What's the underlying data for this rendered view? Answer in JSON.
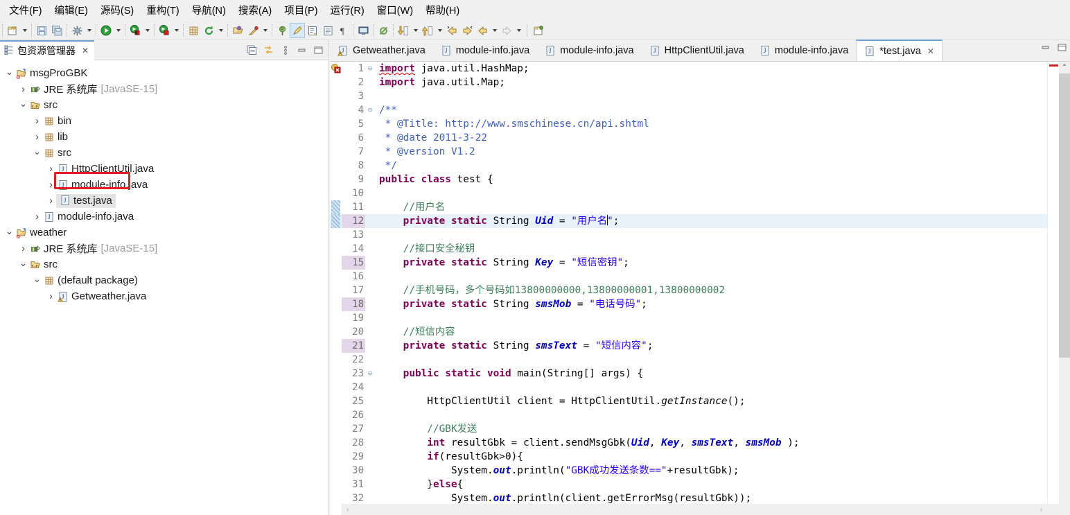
{
  "menu": {
    "items": [
      {
        "label": "文件(F)",
        "name": "menu-file"
      },
      {
        "label": "编辑(E)",
        "name": "menu-edit"
      },
      {
        "label": "源码(S)",
        "name": "menu-source"
      },
      {
        "label": "重构(T)",
        "name": "menu-refactor"
      },
      {
        "label": "导航(N)",
        "name": "menu-navigate"
      },
      {
        "label": "搜索(A)",
        "name": "menu-search"
      },
      {
        "label": "项目(P)",
        "name": "menu-project"
      },
      {
        "label": "运行(R)",
        "name": "menu-run"
      },
      {
        "label": "窗口(W)",
        "name": "menu-window"
      },
      {
        "label": "帮助(H)",
        "name": "menu-help"
      }
    ]
  },
  "toolbar": {
    "buttons": [
      "new-icon",
      "save-icon",
      "save-all-icon",
      "build-icon",
      "run-icon",
      "debug-icon",
      "coverage-icon",
      "new-package-icon",
      "refresh-icon",
      "open-type-icon",
      "search-icon",
      "annotation-icon",
      "marker-icon",
      "toggle-breadcrumb-icon",
      "outline-icon",
      "pilcrow-icon",
      "console-icon",
      "skip-breakpoints-icon",
      "step-down-icon",
      "step-up-icon",
      "prev-annotation-icon",
      "next-annotation-icon",
      "back-icon",
      "forward-icon",
      "new-window-icon"
    ]
  },
  "left_panel": {
    "tab_title": "包资源管理器",
    "tab_close": "✕",
    "tools": [
      "collapse-all-icon",
      "link-with-editor-icon",
      "view-menu-icon",
      "minimize-icon",
      "maximize-icon"
    ],
    "tree": [
      {
        "name": "tree-item-msgprogbk",
        "label": "msgProGBK",
        "sub": "",
        "depth": 0,
        "twisty": "down",
        "icon": "java-project-icon",
        "selected": false
      },
      {
        "name": "tree-item-jre-msgprogbk",
        "label": "JRE 系统库",
        "sub": "[JavaSE-15]",
        "depth": 1,
        "twisty": "right",
        "icon": "library-icon",
        "selected": false
      },
      {
        "name": "tree-item-src-msgprogbk",
        "label": "src",
        "sub": "",
        "depth": 1,
        "twisty": "down",
        "icon": "source-folder-icon",
        "selected": false
      },
      {
        "name": "tree-item-bin",
        "label": "bin",
        "sub": "",
        "depth": 2,
        "twisty": "right",
        "icon": "package-icon",
        "selected": false
      },
      {
        "name": "tree-item-lib",
        "label": "lib",
        "sub": "",
        "depth": 2,
        "twisty": "right",
        "icon": "package-icon",
        "selected": false
      },
      {
        "name": "tree-item-src-pkg",
        "label": "src",
        "sub": "",
        "depth": 2,
        "twisty": "down",
        "icon": "package-icon",
        "selected": false
      },
      {
        "name": "tree-item-httpclientutil",
        "label": "HttpClientUtil.java",
        "sub": "",
        "depth": 3,
        "twisty": "right",
        "icon": "java-file-icon",
        "selected": false
      },
      {
        "name": "tree-item-module-info-1",
        "label": "module-info.java",
        "sub": "",
        "depth": 3,
        "twisty": "right",
        "icon": "java-file-icon",
        "selected": false
      },
      {
        "name": "tree-item-test-java",
        "label": "test.java",
        "sub": "",
        "depth": 3,
        "twisty": "right",
        "icon": "java-file-icon",
        "selected": true
      },
      {
        "name": "tree-item-module-info-2",
        "label": "module-info.java",
        "sub": "",
        "depth": 2,
        "twisty": "right",
        "icon": "java-file-icon",
        "selected": false
      },
      {
        "name": "tree-item-weather",
        "label": "weather",
        "sub": "",
        "depth": 0,
        "twisty": "down",
        "icon": "java-project-icon",
        "selected": false
      },
      {
        "name": "tree-item-jre-weather",
        "label": "JRE 系统库",
        "sub": "[JavaSE-15]",
        "depth": 1,
        "twisty": "right",
        "icon": "library-icon",
        "selected": false
      },
      {
        "name": "tree-item-src-weather",
        "label": "src",
        "sub": "",
        "depth": 1,
        "twisty": "down",
        "icon": "source-folder-icon",
        "selected": false
      },
      {
        "name": "tree-item-default-package",
        "label": "(default package)",
        "sub": "",
        "depth": 2,
        "twisty": "down",
        "icon": "package-icon",
        "selected": false
      },
      {
        "name": "tree-item-getweather",
        "label": "Getweather.java",
        "sub": "",
        "depth": 3,
        "twisty": "right",
        "icon": "java-file-warn-icon",
        "selected": false
      }
    ],
    "highlight_color": "#e81b23"
  },
  "editor": {
    "tabs": [
      {
        "label": "Getweather.java",
        "active": false,
        "icon": "java-file-warn-icon",
        "closable": false
      },
      {
        "label": "module-info.java",
        "active": false,
        "icon": "java-file-icon",
        "closable": false
      },
      {
        "label": "module-info.java",
        "active": false,
        "icon": "java-file-icon",
        "closable": false
      },
      {
        "label": "HttpClientUtil.java",
        "active": false,
        "icon": "java-file-icon",
        "closable": false
      },
      {
        "label": "module-info.java",
        "active": false,
        "icon": "java-file-icon",
        "closable": false
      },
      {
        "label": "*test.java",
        "active": true,
        "icon": "java-file-icon",
        "closable": true
      }
    ],
    "tab_close": "✕",
    "window_buttons": [
      "minimize-icon",
      "maximize-icon"
    ],
    "current_line": 12,
    "lines": [
      {
        "num": "1",
        "fold": "⊖",
        "changed": false,
        "hl_num": false,
        "html": "<span class=\"kw err-squiggle\">import</span><span class=\"pln\"> java.util.HashMap;</span>"
      },
      {
        "num": "2",
        "fold": "",
        "changed": false,
        "hl_num": false,
        "html": "<span class=\"kw\">import</span><span class=\"pln\"> java.util.Map;</span>"
      },
      {
        "num": "3",
        "fold": "",
        "changed": false,
        "hl_num": false,
        "html": ""
      },
      {
        "num": "4",
        "fold": "⊖",
        "changed": false,
        "hl_num": false,
        "html": "<span class=\"doc\">/**</span>"
      },
      {
        "num": "5",
        "fold": "",
        "changed": false,
        "hl_num": false,
        "html": "<span class=\"doc\"> * @Title: http://www.smschinese.cn/api.shtml</span>"
      },
      {
        "num": "6",
        "fold": "",
        "changed": false,
        "hl_num": false,
        "html": "<span class=\"doc\"> * @date 2011-3-22</span>"
      },
      {
        "num": "7",
        "fold": "",
        "changed": false,
        "hl_num": false,
        "html": "<span class=\"doc\"> * @version V1.2</span>"
      },
      {
        "num": "8",
        "fold": "",
        "changed": false,
        "hl_num": false,
        "html": "<span class=\"doc\"> */</span>"
      },
      {
        "num": "9",
        "fold": "",
        "changed": false,
        "hl_num": false,
        "html": "<span class=\"kw\">public class</span><span class=\"pln\"> test {</span>"
      },
      {
        "num": "10",
        "fold": "",
        "changed": false,
        "hl_num": false,
        "html": ""
      },
      {
        "num": "11",
        "fold": "",
        "changed": true,
        "hl_num": false,
        "html": "<span class=\"cmt\">    //用户名</span>"
      },
      {
        "num": "12",
        "fold": "",
        "changed": true,
        "hl_num": true,
        "html": "<span class=\"pln\">    </span><span class=\"kw\">private static</span><span class=\"pln\"> String </span><span class=\"stfld\">Uid</span><span class=\"pln\"> = </span><span class=\"str\">\"用户名</span><span class=\"caret\"></span><span class=\"str\">\"</span><span class=\"pln\">;</span>"
      },
      {
        "num": "13",
        "fold": "",
        "changed": false,
        "hl_num": false,
        "html": ""
      },
      {
        "num": "14",
        "fold": "",
        "changed": false,
        "hl_num": false,
        "html": "<span class=\"cmt\">    //接口安全秘钥</span>"
      },
      {
        "num": "15",
        "fold": "",
        "changed": false,
        "hl_num": true,
        "html": "<span class=\"pln\">    </span><span class=\"kw\">private static</span><span class=\"pln\"> String </span><span class=\"stfld\">Key</span><span class=\"pln\"> = </span><span class=\"str\">\"短信密钥\"</span><span class=\"pln\">;</span>"
      },
      {
        "num": "16",
        "fold": "",
        "changed": false,
        "hl_num": false,
        "html": ""
      },
      {
        "num": "17",
        "fold": "",
        "changed": false,
        "hl_num": false,
        "html": "<span class=\"cmt\">    //手机号码，多个号码如13800000000,13800000001,13800000002</span>"
      },
      {
        "num": "18",
        "fold": "",
        "changed": false,
        "hl_num": true,
        "html": "<span class=\"pln\">    </span><span class=\"kw\">private static</span><span class=\"pln\"> String </span><span class=\"stfld\">smsMob</span><span class=\"pln\"> = </span><span class=\"str\">\"电话号码\"</span><span class=\"pln\">;</span>"
      },
      {
        "num": "19",
        "fold": "",
        "changed": false,
        "hl_num": false,
        "html": ""
      },
      {
        "num": "20",
        "fold": "",
        "changed": false,
        "hl_num": false,
        "html": "<span class=\"cmt\">    //短信内容</span>"
      },
      {
        "num": "21",
        "fold": "",
        "changed": false,
        "hl_num": true,
        "html": "<span class=\"pln\">    </span><span class=\"kw\">private static</span><span class=\"pln\"> String </span><span class=\"stfld\">smsText</span><span class=\"pln\"> = </span><span class=\"str\">\"短信内容\"</span><span class=\"pln\">;</span>"
      },
      {
        "num": "22",
        "fold": "",
        "changed": false,
        "hl_num": false,
        "html": ""
      },
      {
        "num": "23",
        "fold": "⊖",
        "changed": false,
        "hl_num": false,
        "html": "<span class=\"pln\">    </span><span class=\"kw\">public static void</span><span class=\"pln\"> main(String[] args) {</span>"
      },
      {
        "num": "24",
        "fold": "",
        "changed": false,
        "hl_num": false,
        "html": ""
      },
      {
        "num": "25",
        "fold": "",
        "changed": false,
        "hl_num": false,
        "html": "<span class=\"pln\">        HttpClientUtil client = HttpClientUtil.</span><span class=\"mth\">getInstance</span><span class=\"pln\">();</span>"
      },
      {
        "num": "26",
        "fold": "",
        "changed": false,
        "hl_num": false,
        "html": ""
      },
      {
        "num": "27",
        "fold": "",
        "changed": false,
        "hl_num": false,
        "html": "<span class=\"cmt\">        //GBK发送</span>"
      },
      {
        "num": "28",
        "fold": "",
        "changed": false,
        "hl_num": false,
        "html": "<span class=\"pln\">        </span><span class=\"kw\">int</span><span class=\"pln\"> resultGbk = client.sendMsgGbk(</span><span class=\"stfld\">Uid</span><span class=\"pln\">, </span><span class=\"stfld\">Key</span><span class=\"pln\">, </span><span class=\"stfld\">smsText</span><span class=\"pln\">, </span><span class=\"stfld\">smsMob</span><span class=\"pln\"> );</span>"
      },
      {
        "num": "29",
        "fold": "",
        "changed": false,
        "hl_num": false,
        "html": "<span class=\"pln\">        </span><span class=\"kw\">if</span><span class=\"pln\">(resultGbk&gt;0){</span>"
      },
      {
        "num": "30",
        "fold": "",
        "changed": false,
        "hl_num": false,
        "html": "<span class=\"pln\">            System.</span><span class=\"stfld\">out</span><span class=\"pln\">.println(</span><span class=\"str\">\"GBK成功发送条数==\"</span><span class=\"pln\">+resultGbk);</span>"
      },
      {
        "num": "31",
        "fold": "",
        "changed": false,
        "hl_num": false,
        "html": "<span class=\"pln\">        }</span><span class=\"kw\">else</span><span class=\"pln\">{</span>"
      },
      {
        "num": "32",
        "fold": "",
        "changed": false,
        "hl_num": false,
        "html": "<span class=\"pln\">            System.</span><span class=\"stfld\">out</span><span class=\"pln\">.println(client.getErrorMsg(resultGbk));</span>"
      }
    ],
    "error_marker": "error-icon",
    "scroll": {
      "up_arrow": "⌃",
      "down_arrow": "⌄",
      "left_arrow": "‹",
      "right_arrow": "›"
    }
  },
  "colors": {
    "keyword": "#7f0055",
    "string": "#2a00ff",
    "comment": "#3f7f5f",
    "javadoc": "#3f5fbf",
    "field": "#0000c0",
    "current_line": "#e8f2fb",
    "annotation_box": "#e81b23",
    "tab_accent": "#6d9fd1"
  }
}
